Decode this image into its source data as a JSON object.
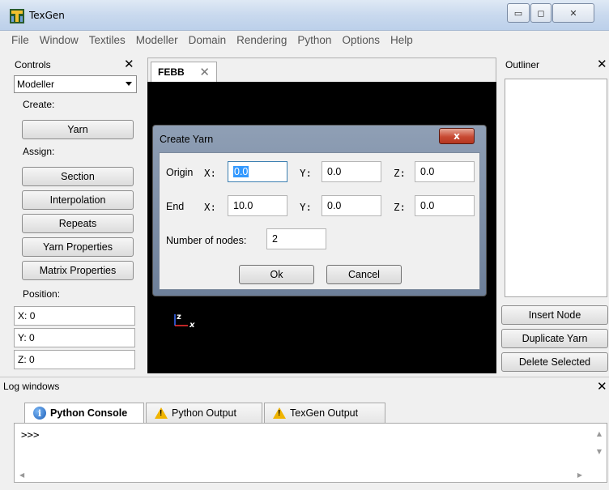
{
  "window": {
    "title": "TexGen",
    "minimize": "▭",
    "maximize": "◻",
    "close": "✕"
  },
  "menu": [
    "File",
    "Window",
    "Textiles",
    "Modeller",
    "Domain",
    "Rendering",
    "Python",
    "Options",
    "Help"
  ],
  "controls": {
    "title": "Controls",
    "close": "✕",
    "mode": "Modeller",
    "create_label": "Create:",
    "yarn_button": "Yarn",
    "assign_label": "Assign:",
    "assign_buttons": [
      "Section",
      "Interpolation",
      "Repeats",
      "Yarn Properties",
      "Matrix Properties"
    ],
    "position_label": "Position:",
    "position": [
      {
        "axis": "X:",
        "value": "0"
      },
      {
        "axis": "Y:",
        "value": "0"
      },
      {
        "axis": "Z:",
        "value": "0"
      }
    ]
  },
  "document": {
    "tab": "FEBB",
    "tab_close": "✕",
    "axis_z": "z",
    "axis_x": "x"
  },
  "dialog": {
    "title": "Create Yarn",
    "close": "x",
    "origin_label": "Origin",
    "end_label": "End",
    "x_label": "X:",
    "y_label": "Y:",
    "z_label": "Z:",
    "origin": {
      "x": "0.0",
      "y": "0.0",
      "z": "0.0"
    },
    "end": {
      "x": "10.0",
      "y": "0.0",
      "z": "0.0"
    },
    "nodes_label": "Number of nodes:",
    "nodes": "2",
    "ok": "Ok",
    "cancel": "Cancel"
  },
  "outliner": {
    "title": "Outliner",
    "close": "✕",
    "buttons": [
      "Insert Node",
      "Duplicate Yarn",
      "Delete Selected"
    ]
  },
  "log": {
    "title": "Log windows",
    "close": "✕",
    "tabs": [
      "Python Console",
      "Python Output",
      "TexGen Output"
    ],
    "prompt": ">>>"
  }
}
